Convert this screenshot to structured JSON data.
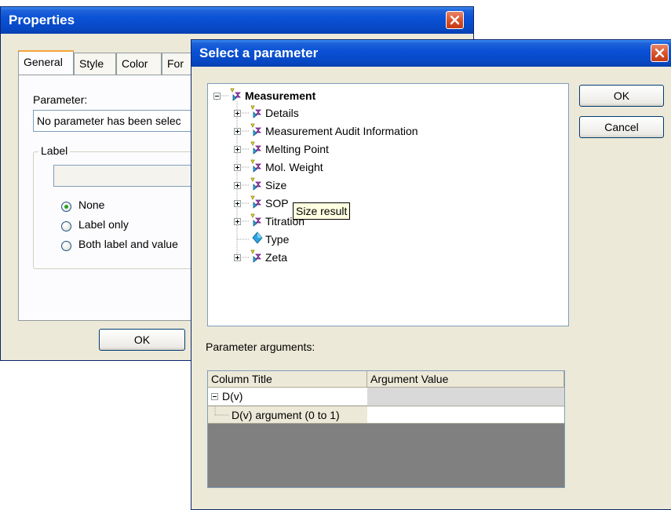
{
  "properties": {
    "title": "Properties",
    "tabs": [
      "General",
      "Style",
      "Color",
      "For"
    ],
    "parameter_label": "Parameter:",
    "parameter_value": "No parameter has been selec",
    "label_group": "Label",
    "radios": [
      {
        "label": "None",
        "checked": true
      },
      {
        "label": "Label only",
        "checked": false
      },
      {
        "label": "Both label and value",
        "checked": false
      }
    ],
    "ok_label": "OK"
  },
  "select": {
    "title": "Select a parameter",
    "ok_label": "OK",
    "cancel_label": "Cancel",
    "tree": {
      "root": "Measurement",
      "items": [
        "Details",
        "Measurement Audit Information",
        "Melting Point",
        "Mol. Weight",
        "Size",
        "SOP",
        "Titration",
        "Type",
        "Zeta"
      ]
    },
    "tooltip": "Size result",
    "arguments_label": "Parameter arguments:",
    "grid": {
      "columns": [
        "Column Title",
        "Argument Value"
      ],
      "rows": [
        {
          "title": "D(v)",
          "value": ""
        },
        {
          "title": "D(v) argument (0 to 1)",
          "value": ""
        }
      ]
    }
  }
}
